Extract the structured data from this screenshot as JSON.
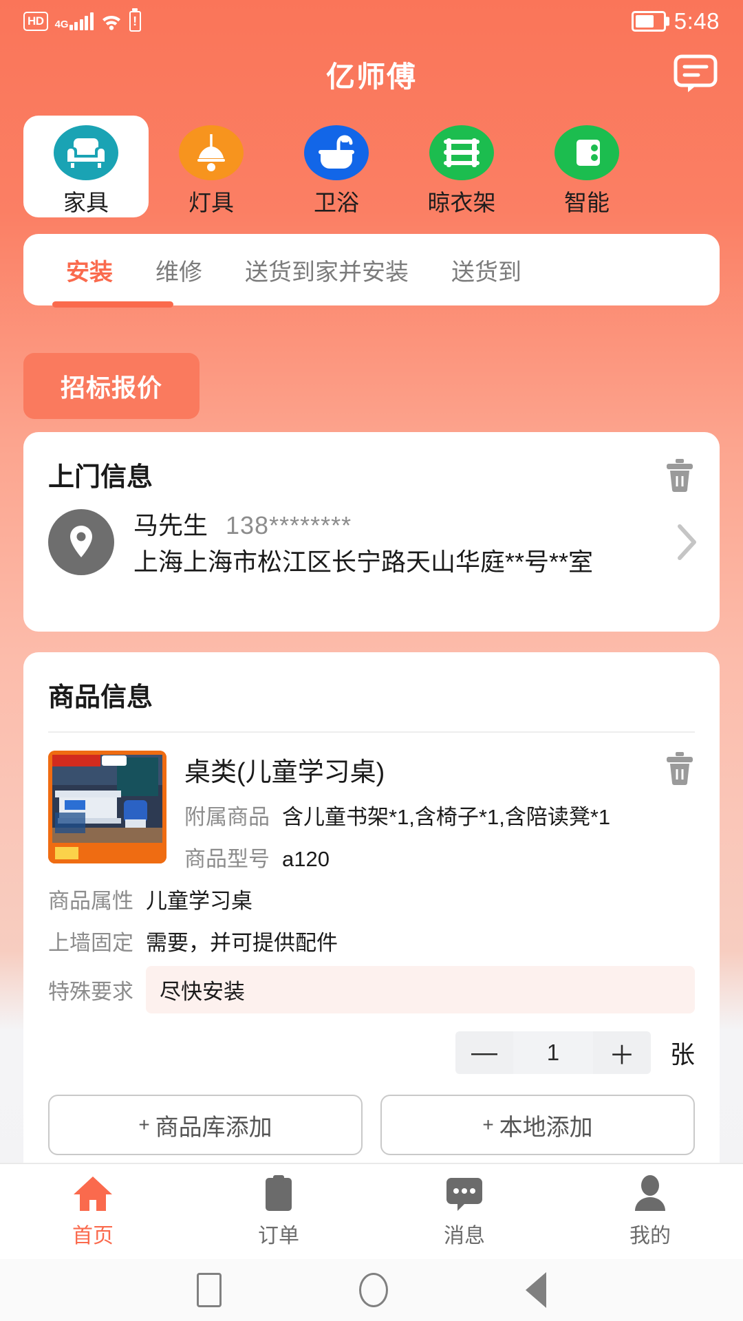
{
  "statusbar": {
    "hd": "HD",
    "network": "4G",
    "time": "5:48",
    "icons": [
      "hd-badge",
      "signal-bars",
      "wifi",
      "battery-small",
      "battery-large"
    ]
  },
  "header": {
    "title": "亿师傅",
    "chat_icon": "chat-bubble-icon"
  },
  "categories": [
    {
      "label": "家具",
      "icon": "sofa-icon",
      "color": "#1aa3b4",
      "active": true
    },
    {
      "label": "灯具",
      "icon": "pendant-lamp-icon",
      "color": "#f7941e",
      "active": false
    },
    {
      "label": "卫浴",
      "icon": "bathtub-icon",
      "color": "#1266e8",
      "active": false
    },
    {
      "label": "晾衣架",
      "icon": "clothes-rack-icon",
      "color": "#1cbd4f",
      "active": false
    },
    {
      "label": "智能",
      "icon": "smart-device-icon",
      "color": "#1cbd4f",
      "active": false
    }
  ],
  "service_tabs": [
    {
      "label": "安装",
      "active": true
    },
    {
      "label": "维修",
      "active": false
    },
    {
      "label": "送货到家并安装",
      "active": false
    },
    {
      "label": "送货到",
      "active": false
    }
  ],
  "bid_button": {
    "label": "招标报价"
  },
  "visit_card": {
    "title": "上门信息",
    "delete_icon": "trash-icon",
    "location_icon": "map-pin-icon",
    "contact_name": "马先生",
    "contact_phone": "138********",
    "address": "上海上海市松江区长宁路天山华庭**号**室",
    "chevron_icon": "chevron-right-icon"
  },
  "goods_card": {
    "title": "商品信息",
    "delete_icon": "trash-icon",
    "thumbnail_alt": "儿童学习桌商品图",
    "product_name": "桌类(儿童学习桌)",
    "fields": [
      {
        "key": "附属商品",
        "value": "含儿童书架*1,含椅子*1,含陪读凳*1"
      },
      {
        "key": "商品型号",
        "value": "a120"
      }
    ],
    "fields_wide": [
      {
        "key": "商品属性",
        "value": "儿童学习桌"
      },
      {
        "key": "上墙固定",
        "value": "需要，并可提供配件"
      }
    ],
    "special": {
      "key": "特殊要求",
      "value": "尽快安装"
    },
    "quantity": {
      "minus": "—",
      "value": "1",
      "plus": "＋",
      "unit": "张"
    },
    "add_buttons": [
      {
        "plus": "+",
        "label": "商品库添加"
      },
      {
        "plus": "+",
        "label": "本地添加"
      }
    ]
  },
  "bottom_nav": [
    {
      "label": "首页",
      "icon": "home-icon",
      "active": true
    },
    {
      "label": "订单",
      "icon": "clipboard-icon",
      "active": false
    },
    {
      "label": "消息",
      "icon": "message-icon",
      "active": false
    },
    {
      "label": "我的",
      "icon": "person-icon",
      "active": false
    }
  ],
  "system_nav": [
    {
      "icon": "recents-square-icon"
    },
    {
      "icon": "home-circle-icon"
    },
    {
      "icon": "back-triangle-icon"
    }
  ],
  "colors": {
    "brand": "#fa6a4d",
    "bid_button": "#fa7a5e",
    "header_bg": "#fa7559"
  }
}
